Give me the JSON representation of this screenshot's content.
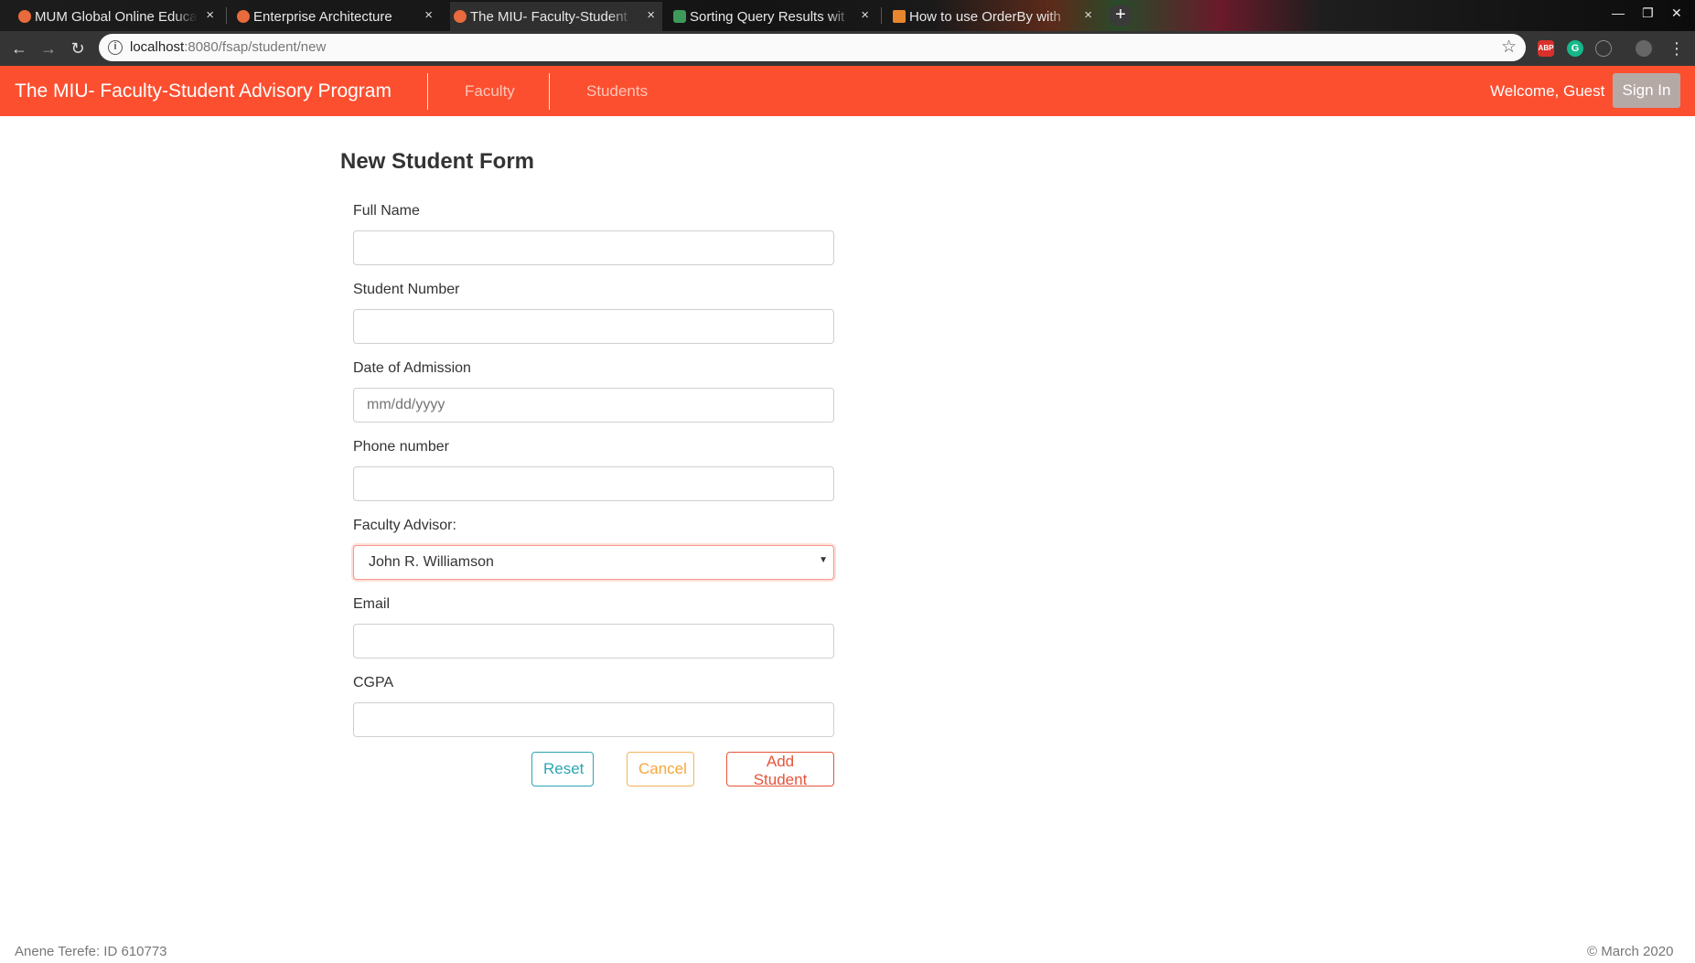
{
  "browser": {
    "tabs": [
      {
        "title": "MUM Global Online Educa",
        "icon": "globe-icon"
      },
      {
        "title": "Enterprise Architecture",
        "icon": "globe-icon"
      },
      {
        "title": "The MIU- Faculty-Student",
        "icon": "globe-icon",
        "active": true
      },
      {
        "title": "Sorting Query Results wit",
        "icon": "leaf-icon"
      },
      {
        "title": "How to use OrderBy with",
        "icon": "stackoverflow-icon"
      }
    ],
    "close_glyph": "×",
    "new_tab_glyph": "+",
    "url_host": "localhost",
    "url_rest": ":8080/fsap/student/new",
    "extensions": [
      "ABP",
      "G"
    ]
  },
  "navbar": {
    "brand": "The MIU- Faculty-Student Advisory Program",
    "links": [
      "Faculty",
      "Students"
    ],
    "welcome": "Welcome, Guest",
    "signin": "Sign In",
    "accent": "#fc4f30"
  },
  "form": {
    "title": "New Student Form",
    "fields": {
      "full_name": {
        "label": "Full Name",
        "value": ""
      },
      "student_number": {
        "label": "Student Number",
        "value": ""
      },
      "admission_date": {
        "label": "Date of Admission",
        "placeholder": "mm/dd/yyyy"
      },
      "phone": {
        "label": "Phone number",
        "value": ""
      },
      "advisor": {
        "label": "Faculty Advisor:",
        "selected": "John R. Williamson"
      },
      "email": {
        "label": "Email",
        "value": ""
      },
      "cgpa": {
        "label": "CGPA",
        "value": ""
      }
    },
    "buttons": {
      "reset": "Reset",
      "cancel": "Cancel",
      "add": "Add Student"
    }
  },
  "footer": {
    "left": "Anene Terefe: ID 610773",
    "right": "© March 2020"
  }
}
